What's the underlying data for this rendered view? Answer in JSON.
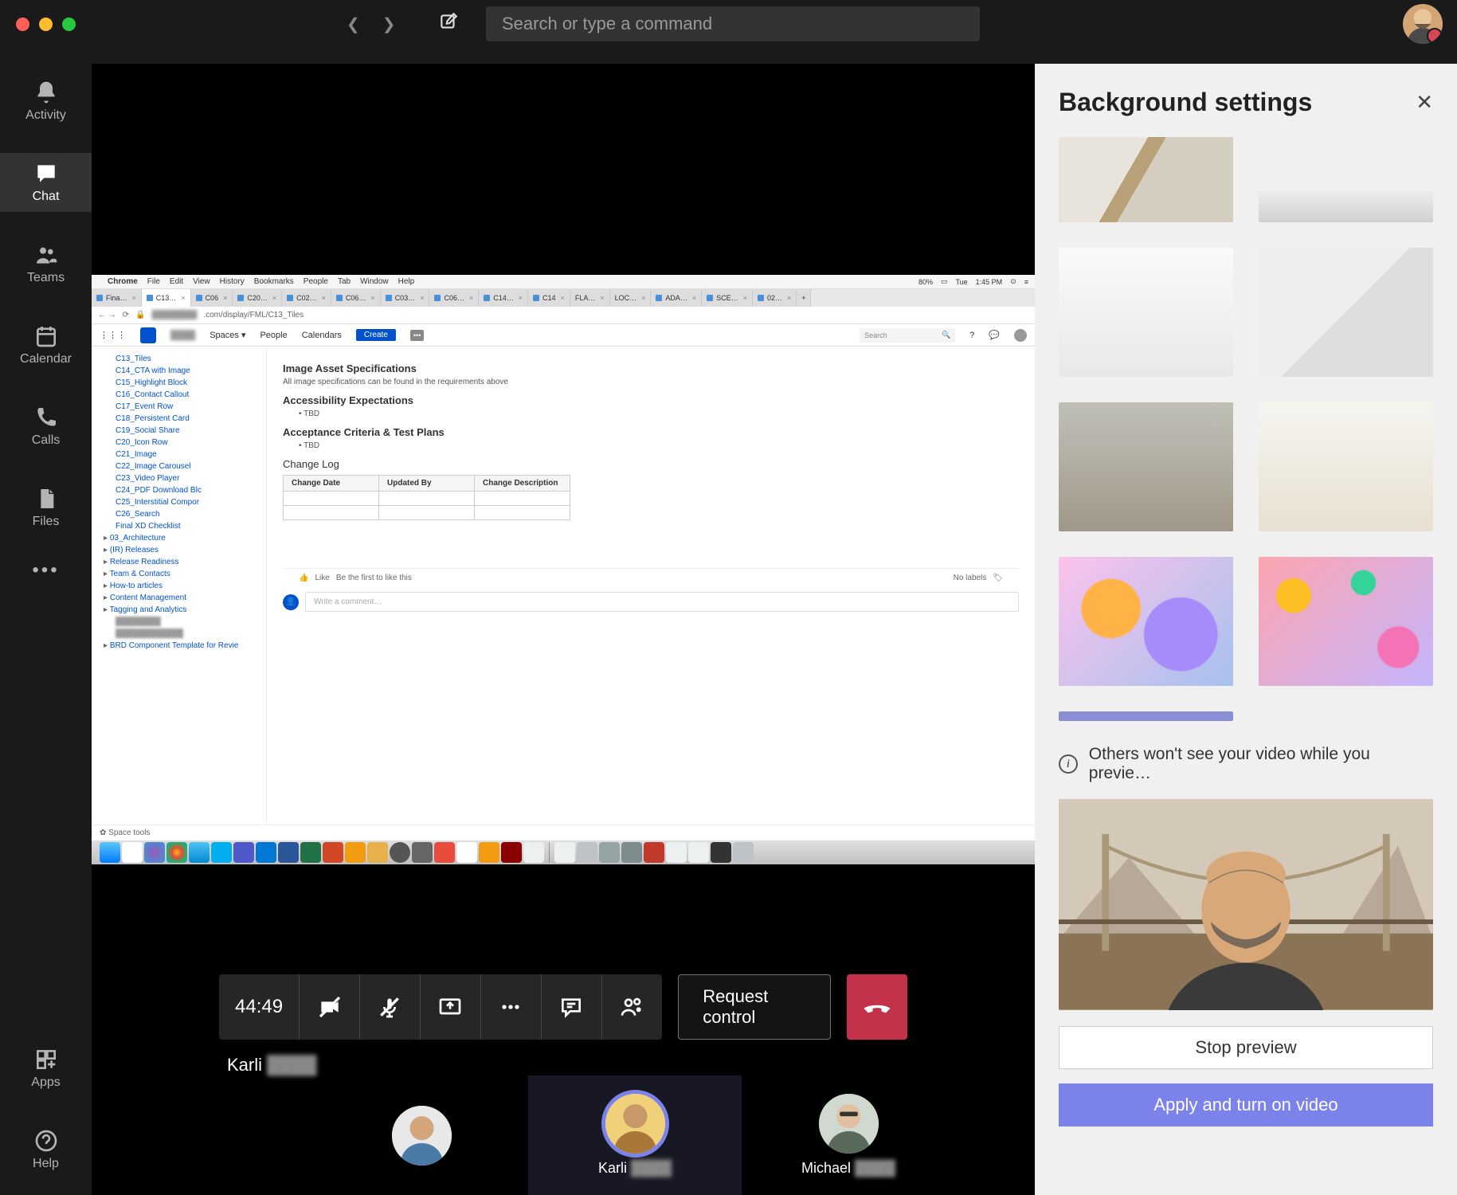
{
  "titlebar": {
    "search_placeholder": "Search or type a command"
  },
  "rail": {
    "activity": "Activity",
    "chat": "Chat",
    "teams": "Teams",
    "calendar": "Calendar",
    "calls": "Calls",
    "files": "Files",
    "apps": "Apps",
    "help": "Help"
  },
  "mac_menu": {
    "browser": "Chrome",
    "items": [
      "File",
      "Edit",
      "View",
      "History",
      "Bookmarks",
      "People",
      "Tab",
      "Window",
      "Help"
    ],
    "battery": "80%",
    "day": "Tue",
    "time": "1:45 PM"
  },
  "tabs": [
    "Fina…",
    "C13…",
    "C06",
    "C20…",
    "C02…",
    "C06…",
    "C03…",
    "C06…",
    "C14…",
    "C14",
    "FLA…",
    "LOC…",
    "ADA…",
    "SCE…",
    "02…"
  ],
  "url": ".com/display/FML/C13_Tiles",
  "conf_toolbar": {
    "spaces": "Spaces",
    "people": "People",
    "calendars": "Calendars",
    "create": "Create",
    "search_placeholder": "Search"
  },
  "sidebar_items": [
    {
      "label": "C13_Tiles"
    },
    {
      "label": "C14_CTA with Image"
    },
    {
      "label": "C15_Highlight Block"
    },
    {
      "label": "C16_Contact Callout"
    },
    {
      "label": "C17_Event Row"
    },
    {
      "label": "C18_Persistent Card"
    },
    {
      "label": "C19_Social Share"
    },
    {
      "label": "C20_Icon Row"
    },
    {
      "label": "C21_Image"
    },
    {
      "label": "C22_Image Carousel"
    },
    {
      "label": "C23_Video Player"
    },
    {
      "label": "C24_PDF Download Blc"
    },
    {
      "label": "C25_Interstitial Compor"
    },
    {
      "label": "C26_Search"
    },
    {
      "label": "Final XD Checklist"
    }
  ],
  "sidebar_tree": [
    "03_Architecture",
    "(IR) Releases",
    "Release Readiness",
    "Team & Contacts",
    "How-to articles",
    "Content Management",
    "Tagging and Analytics",
    "",
    "",
    "BRD Component Template for Revie"
  ],
  "doc": {
    "h_image": "Image Asset Specifications",
    "p_image": "All image specifications can be found in the requirements above",
    "h_access": "Accessibility Expectations",
    "tbd": "TBD",
    "h_accept": "Acceptance Criteria & Test Plans",
    "h_change": "Change Log",
    "th1": "Change Date",
    "th2": "Updated By",
    "th3": "Change Description",
    "like": "Like",
    "like_prompt": "Be the first to like this",
    "no_labels": "No labels",
    "comment_placeholder": "Write a comment…",
    "spacetools": "Space tools"
  },
  "call": {
    "timer": "44:49",
    "request": "Request control",
    "presenter": "Karli"
  },
  "participants": [
    {
      "name": ""
    },
    {
      "name": "Karli"
    },
    {
      "name": "Michael"
    }
  ],
  "panel": {
    "title": "Background settings",
    "notice": "Others won't see your video while you previe…",
    "stop": "Stop preview",
    "apply": "Apply and turn on video"
  }
}
